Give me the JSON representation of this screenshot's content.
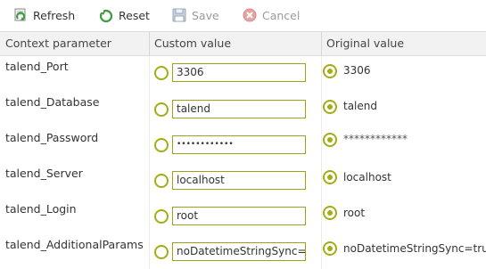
{
  "toolbar": {
    "refresh_label": "Refresh",
    "reset_label": "Reset",
    "save_label": "Save",
    "cancel_label": "Cancel",
    "disabled_color": "#9a9a9a"
  },
  "table": {
    "headers": {
      "context_parameter": "Context parameter",
      "custom_value": "Custom value",
      "original_value": "Original value"
    },
    "rows": [
      {
        "param": "talend_Port",
        "custom_value": "3306",
        "custom_selected": false,
        "original_value": "3306",
        "original_selected": true
      },
      {
        "param": "talend_Database",
        "custom_value": "talend",
        "custom_selected": false,
        "original_value": "talend",
        "original_selected": true
      },
      {
        "param": "talend_Password",
        "custom_value": "••••••••••••",
        "custom_selected": false,
        "original_value": "************",
        "original_selected": true
      },
      {
        "param": "talend_Server",
        "custom_value": "localhost",
        "custom_selected": false,
        "original_value": "localhost",
        "original_selected": true
      },
      {
        "param": "talend_Login",
        "custom_value": "root",
        "custom_selected": false,
        "original_value": "root",
        "original_selected": true
      },
      {
        "param": "talend_AdditionalParams",
        "custom_value": "noDatetimeStringSync=true",
        "custom_selected": false,
        "original_value": "noDatetimeStringSync=true",
        "original_selected": true
      }
    ]
  },
  "colors": {
    "radio_accent": "#a3ad14",
    "field_border": "#9aa31a",
    "header_bg": "#f2f2f2"
  }
}
